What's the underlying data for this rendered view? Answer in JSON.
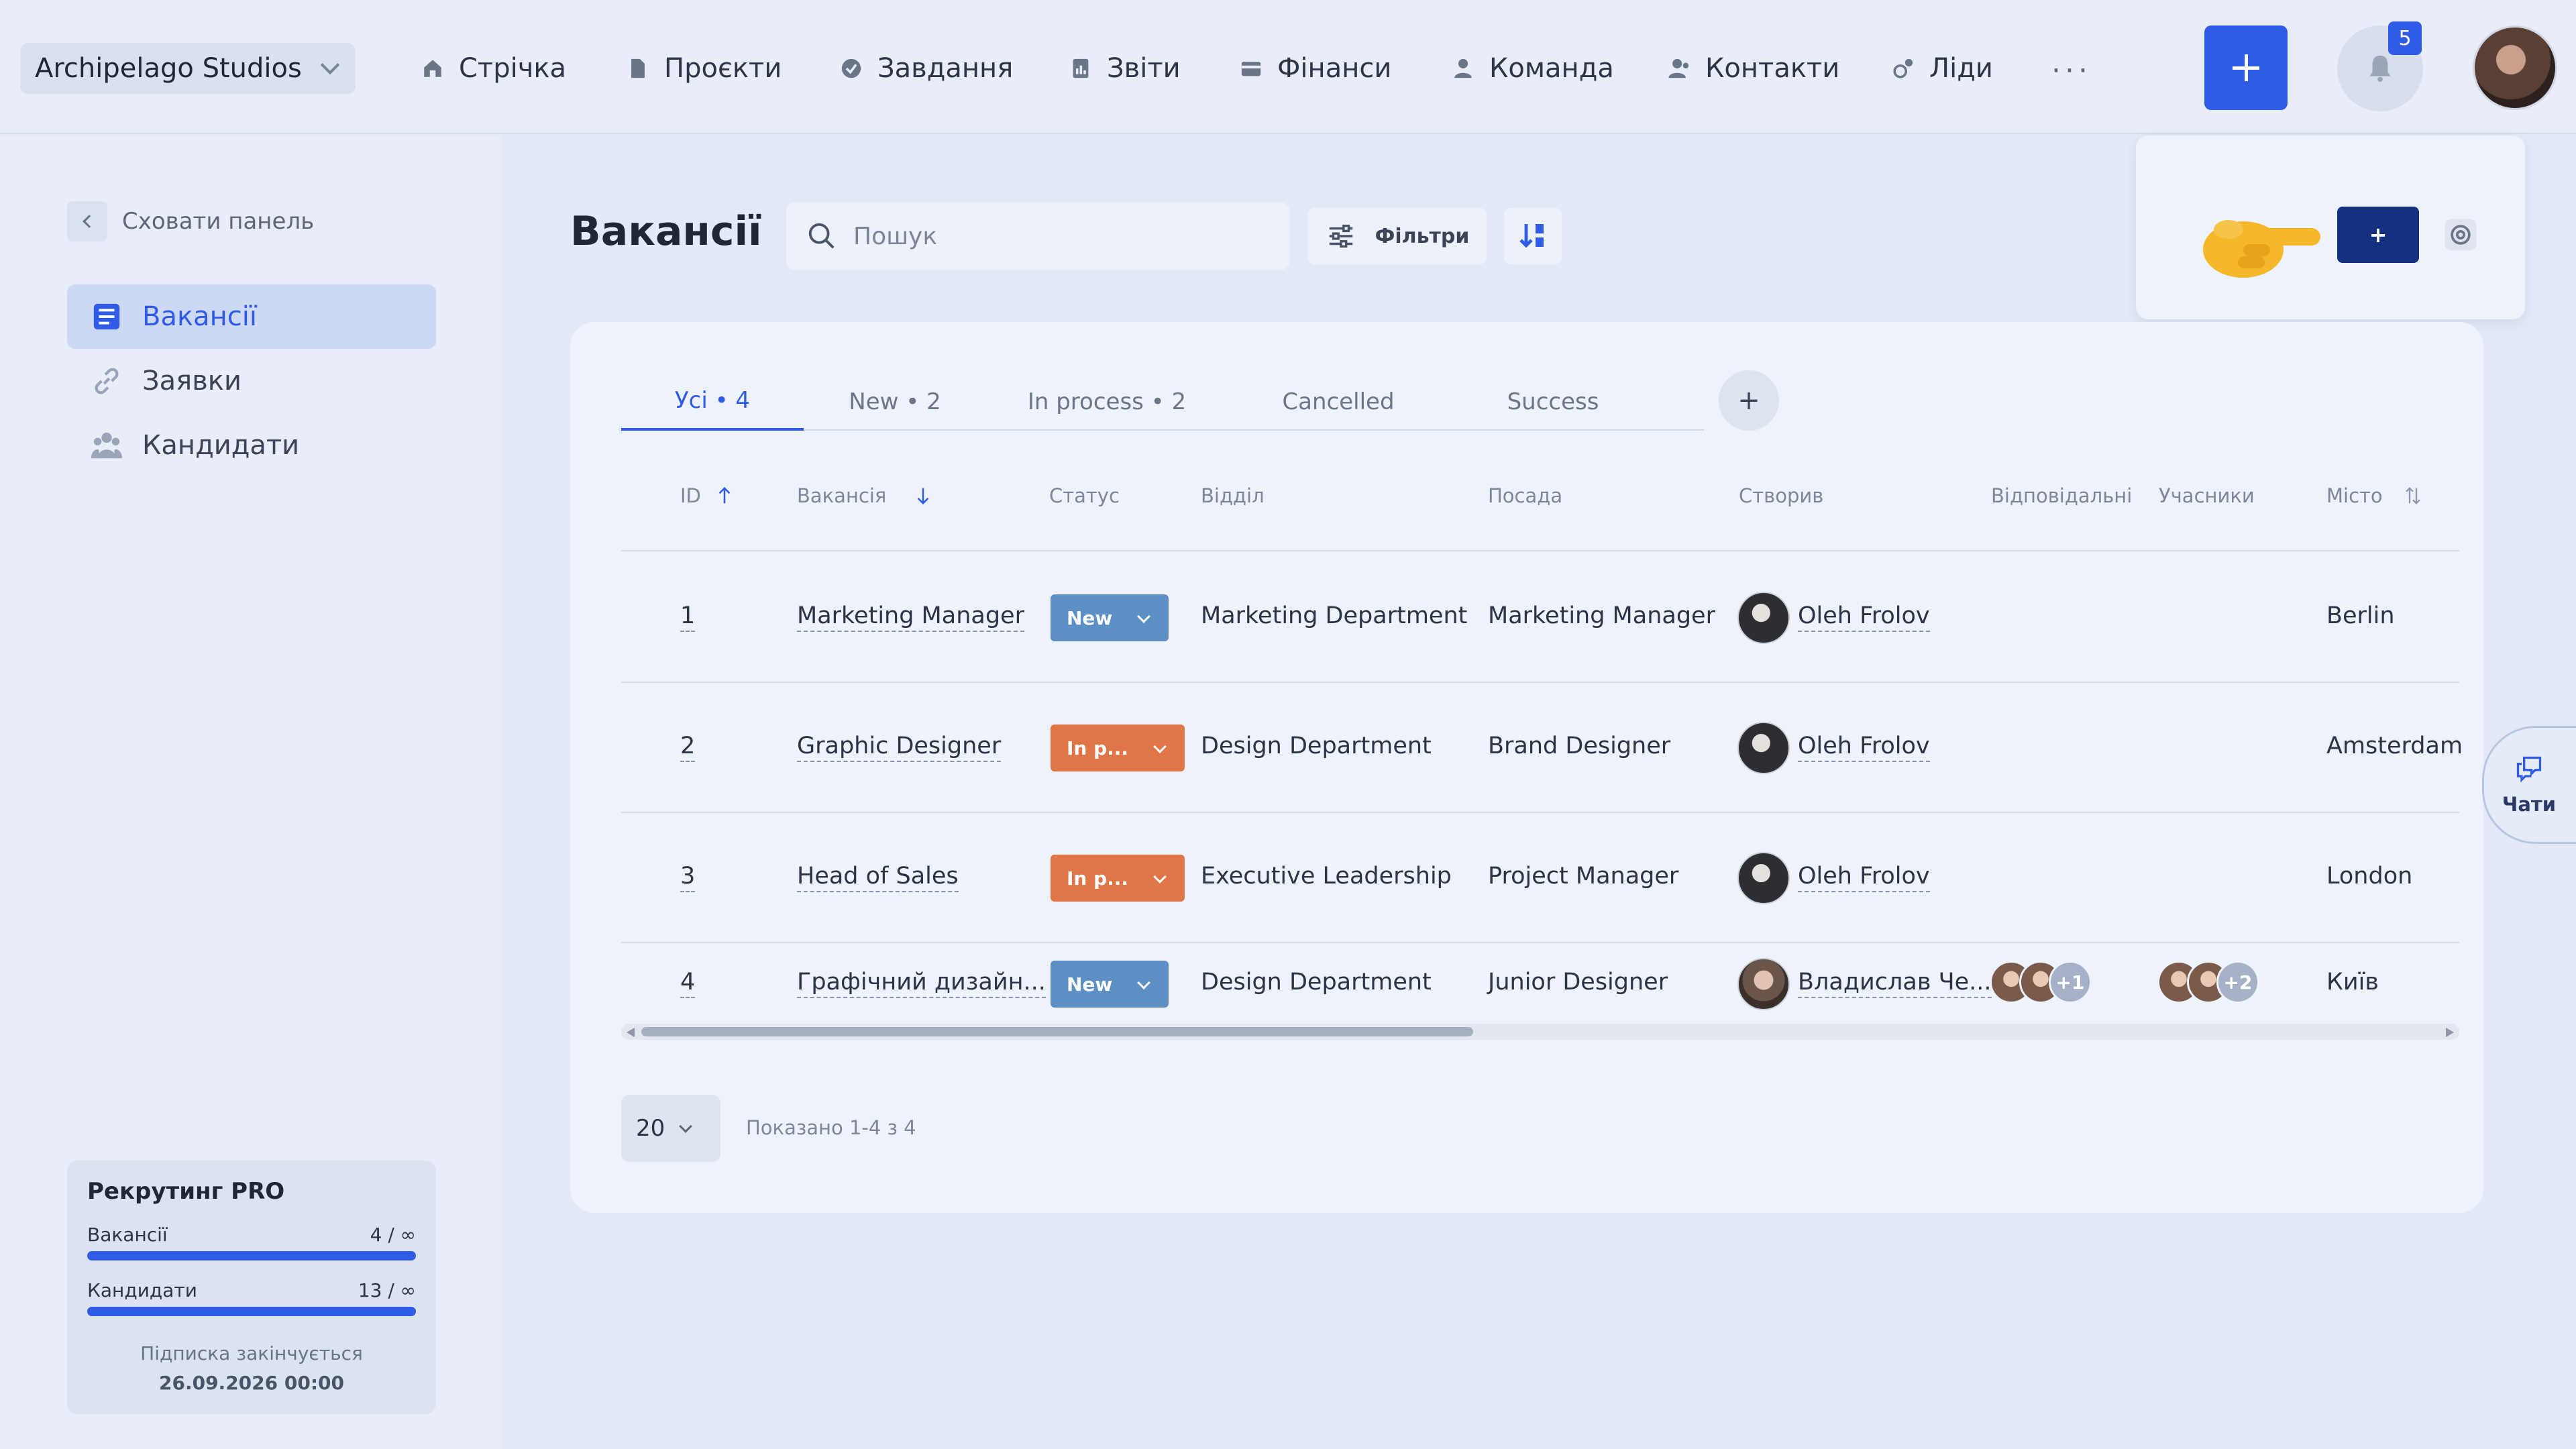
{
  "workspace": {
    "name": "Archipelago Studios"
  },
  "nav": [
    {
      "label": "Стрічка",
      "icon": "home-icon"
    },
    {
      "label": "Проєкти",
      "icon": "file-icon"
    },
    {
      "label": "Завдання",
      "icon": "check-circle-icon"
    },
    {
      "label": "Звіти",
      "icon": "report-icon"
    },
    {
      "label": "Фінанси",
      "icon": "wallet-icon"
    },
    {
      "label": "Команда",
      "icon": "user-icon"
    },
    {
      "label": "Контакти",
      "icon": "contacts-icon"
    },
    {
      "label": "Ліди",
      "icon": "leads-icon"
    }
  ],
  "header": {
    "more": "···",
    "notifications_count": "5"
  },
  "sidebar": {
    "hide_label": "Сховати панель",
    "items": [
      {
        "label": "Вакансії",
        "icon": "list-icon",
        "active": true
      },
      {
        "label": "Заявки",
        "icon": "link-icon",
        "active": false
      },
      {
        "label": "Кандидати",
        "icon": "people-icon",
        "active": false
      }
    ],
    "plan": {
      "title": "Рекрутинг PRO",
      "vacancies_label": "Вакансії",
      "vacancies_value": "4 / ∞",
      "candidates_label": "Кандидати",
      "candidates_value": "13 / ∞",
      "expires_label": "Підписка закінчується",
      "expires_date": "26.09.2026 00:00"
    }
  },
  "page": {
    "title": "Вакансії",
    "search_placeholder": "Пошук",
    "filters_label": "Фільтри",
    "tip_plus_label": "+"
  },
  "tabs": [
    {
      "label": "Усі • 4",
      "active": true
    },
    {
      "label": "New • 2",
      "active": false
    },
    {
      "label": "In process • 2",
      "active": false
    },
    {
      "label": "Cancelled",
      "active": false
    },
    {
      "label": "Success",
      "active": false
    }
  ],
  "tab_add": "+",
  "table": {
    "columns": [
      "ID",
      "Вакансія",
      "Статус",
      "Відділ",
      "Посада",
      "Створив",
      "Відповідальні",
      "Учасники",
      "Місто"
    ],
    "rows": [
      {
        "id": "1",
        "vacancy": "Marketing Manager",
        "status": "New",
        "department": "Marketing Department",
        "position": "Marketing Manager",
        "creator": "Oleh Frolov",
        "responsible_more": "",
        "participants_more": "",
        "city": "Berlin"
      },
      {
        "id": "2",
        "vacancy": "Graphic Designer",
        "status": "In p...",
        "department": "Design Department",
        "position": "Brand Designer",
        "creator": "Oleh Frolov",
        "responsible_more": "",
        "participants_more": "",
        "city": "Amsterdam"
      },
      {
        "id": "3",
        "vacancy": "Head of Sales",
        "status": "In p...",
        "department": "Executive Leadership",
        "position": "Project Manager",
        "creator": "Oleh Frolov",
        "responsible_more": "",
        "participants_more": "",
        "city": "London"
      },
      {
        "id": "4",
        "vacancy": "Графічний дизайн...",
        "status": "New",
        "department": "Design Department",
        "position": "Junior Designer",
        "creator": "Владислав Че...",
        "responsible_more": "+1",
        "participants_more": "+2",
        "city": "Київ"
      }
    ]
  },
  "pagination": {
    "per_page": "20",
    "shown": "Показано 1-4 з 4"
  },
  "chat": {
    "label": "Чати"
  },
  "colors": {
    "accent": "#2f5be6",
    "status_new": "#5c8fc4",
    "status_in_process": "#e07548",
    "tip_button": "#14307e"
  }
}
